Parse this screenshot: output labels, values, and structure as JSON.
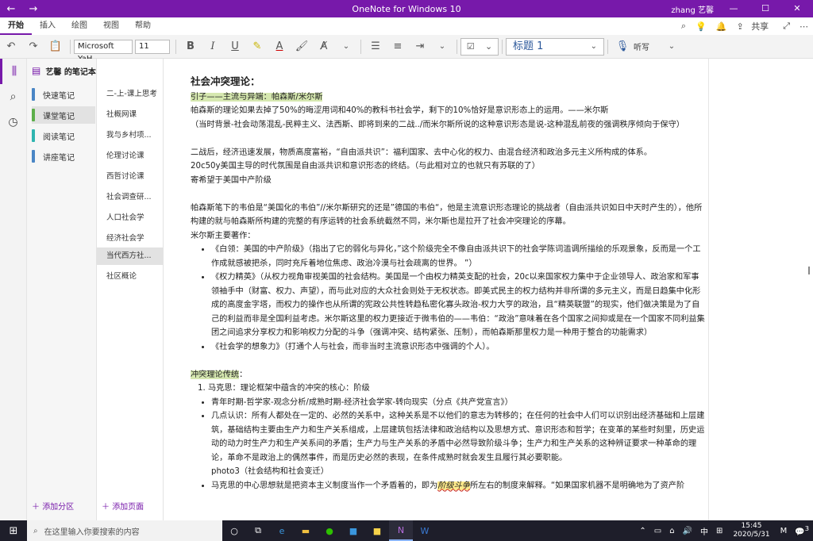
{
  "titlebar": {
    "title": "OneNote for Windows 10",
    "user": "zhang 艺馨"
  },
  "menu": {
    "tabs": [
      "开始",
      "插入",
      "绘图",
      "视图",
      "帮助"
    ],
    "share": "共享"
  },
  "ribbon": {
    "font_name": "Microsoft YaH",
    "font_size": "11",
    "style": "标题 1",
    "dictate": "听写"
  },
  "notebook": {
    "name": "艺馨 的笔记本"
  },
  "sections": [
    {
      "label": "快速笔记",
      "color": "#4a86c5"
    },
    {
      "label": "课堂笔记",
      "color": "#5cae4a"
    },
    {
      "label": "阅读笔记",
      "color": "#2fb5b0"
    },
    {
      "label": "讲座笔记",
      "color": "#4a86c5"
    }
  ],
  "pages": [
    "二-上-课上思考",
    "社概网课",
    "我与乡村项...",
    "伦理讨论课",
    "西哲讨论课",
    "社会调查研...",
    "人口社会学",
    "经济社会学",
    "当代西方社...",
    "社区概论"
  ],
  "add_section": "添加分区",
  "add_page": "添加页面",
  "note": {
    "title": "社会冲突理论：",
    "intro": "引子——主流与异端：帕森斯/米尔斯",
    "p1": "帕森斯的理论如果去掉了50%的晦涩用词和40%的教科书社会学，剩下的10%恰好是意识形态上的运用。——米尔斯",
    "p2": "（当时背景-社会动荡混乱-民粹主义、法西斯、即将到来的二战../而米尔斯所说的这种意识形态是说-这种混乱前夜的强调秩序倾向于保守）",
    "p3": "二战后，经济迅速发展，物质高度富裕，“自由派共识”：福利国家、去中心化的权力、由混合经济和政治多元主义所构成的体系。",
    "p4": "20c50y美国主导的时代氛围是自由派共识和意识形态的终结。（与此相对立的也就只有苏联的了）",
    "p5": "寄希望于美国中产阶级",
    "p6": "帕森斯笔下的韦伯是“美国化的韦伯”//米尔斯研究的还是”德国的韦伯“，他是主流意识形态理论的挑战者（自由派共识如日中天时产生的），他所构建的就与帕森斯所构建的完整的有序运转的社会系统截然不同，米尔斯也是拉开了社会冲突理论的序幕。",
    "p7": "米尔斯主要著作：",
    "bullets": [
      "《白领：美国的中产阶级》（指出了它的弱化与异化，”这个阶级完全不像自由派共识下的社会学陈词滥调所描绘的乐观景象，反而是一个工作成就感被把杀，同时充斥着地位焦虑、政治冷漠与社会疏离的世界。 ”）",
      "《权力精英》（从权力视角审视美国的社会结构。美国是一个由权力精英支配的社会，20c以来国家权力集中于企业领导人、政治家和军事领袖手中（财富、权力、声望），而与此对应的大众社会则处于无权状态。即美式民主的权力结构并非所谓的多元主义，而是日趋集中化形成的高度金字塔，而权力的操作也从所谓的宪政公共性转趋私密化寡头政治-权力大亨的政治，且“精英联盟”的现实，他们做决策是为了自己的利益而非是全国利益考虑。米尔斯这里的权力更接近于微韦伯的——韦伯：“政治”意味着在各个国家之间抑或是在一个国家不同利益集团之间追求分享权力和影响权力分配的斗争（强调冲突、结构紧张、压制），而帕森斯那里权力是一种用于整合的功能需求）",
      "《社会学的想象力》（打通个人与社会，而非当时主流意识形态中强调的个人）。"
    ],
    "conflict_head": "冲突理论传统",
    "conflict_colon": "：",
    "ol1": "马克思：理论框架中蕴含的冲突的核心：阶级",
    "sub": [
      "青年时期-哲学家-观念分析/成熟时期-经济社会学家-转向现实（分点《共产党宣言》）",
      "几点认识：所有人都处在一定的、必然的关系中，这种关系是不以他们的意志为转移的；在任何的社会中人们可以识别出经济基础和上层建筑，基础结构主要由生产力和生产关系组成，上层建筑包括法律和政治结构以及思想方式、意识形态和哲学；在变革的某些时刻里，历史运动的动力时生产力和生产关系间的矛盾；生产力与生产关系的矛盾中必然导致阶级斗争；生产力和生产关系的这种辨证要求一种革命的理论，革命不是政治上的偶然事件，而是历史必然的表现，在条件成熟时就会发生且履行其必要职能。"
    ],
    "photo": "photo3（社会结构和社会变迁）",
    "last_pre": "马克思的中心思想就是把资本主义制度当作一个矛盾着的，即为",
    "last_hl": "阶级斗争",
    "last_post": "所左右的制度来解释。“如果国家机器不是明确地为了资产阶"
  },
  "taskbar": {
    "search_placeholder": "在这里输入你要搜索的内容",
    "ime": "中",
    "time": "15:45",
    "date": "2020/5/31",
    "notification_count": "3"
  }
}
